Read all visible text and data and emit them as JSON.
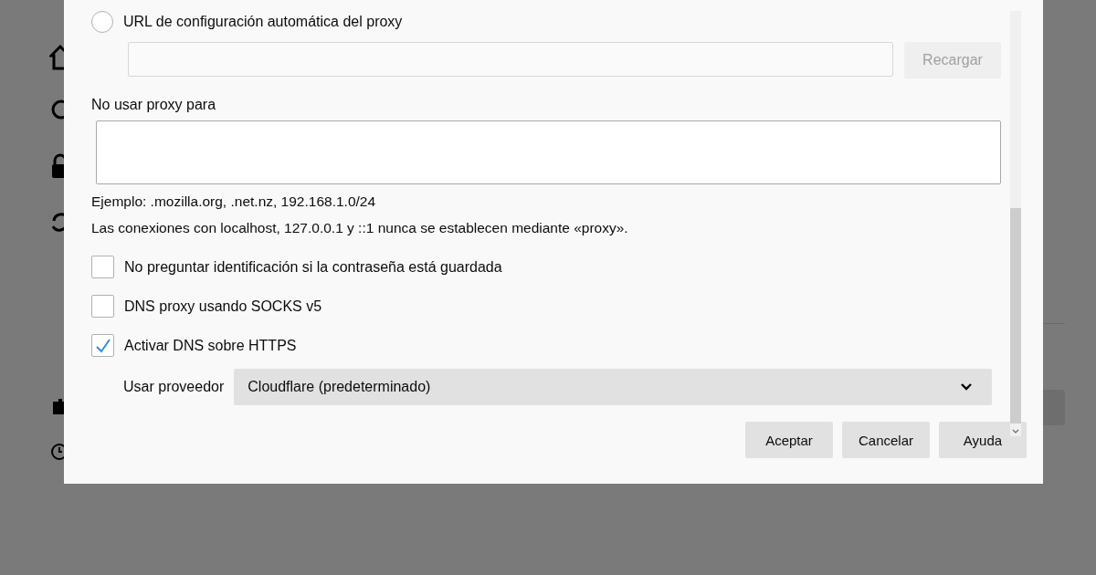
{
  "proxy_autoconfig": {
    "label": "URL de configuración automática del proxy",
    "selected": false
  },
  "reload_button": {
    "label": "Recargar",
    "disabled": true
  },
  "no_proxy": {
    "label": "No usar proxy para"
  },
  "hints": [
    "Ejemplo: .mozilla.org, .net.nz, 192.168.1.0/24",
    "Las conexiones con localhost, 127.0.0.1 y ::1 nunca se establecen mediante «proxy»."
  ],
  "options": [
    {
      "label": "No preguntar identificación si la contraseña está guardada",
      "checked": false
    },
    {
      "label": "DNS proxy usando SOCKS v5",
      "checked": false
    },
    {
      "label": "Activar DNS sobre HTTPS",
      "checked": true
    }
  ],
  "provider": {
    "label": "Usar proveedor",
    "value": "Cloudflare (predeterminado)"
  },
  "buttons": [
    {
      "label": "Aceptar"
    },
    {
      "label": "Cancelar"
    },
    {
      "label": "Ayuda"
    }
  ]
}
